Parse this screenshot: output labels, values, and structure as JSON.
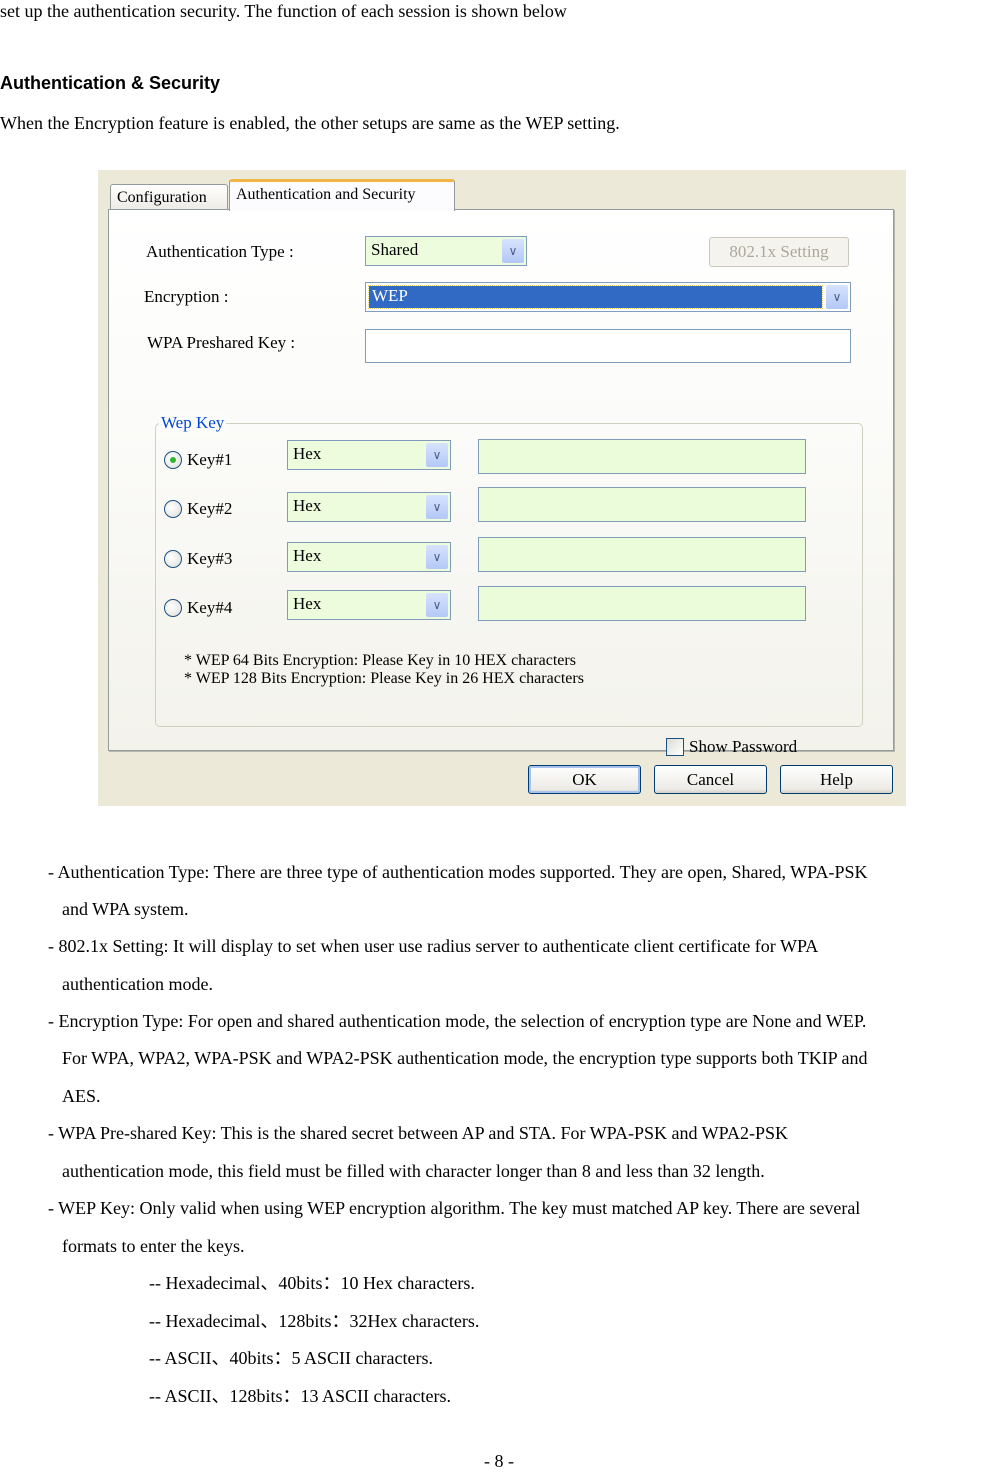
{
  "intro_text": "set up the authentication security. The function of each session is shown below",
  "section_heading": "Authentication & Security",
  "section_intro": "When the Encryption feature is enabled, the other setups are same as the WEP setting.",
  "dialog": {
    "tabs": [
      {
        "label": "Configuration",
        "active": false
      },
      {
        "label": "Authentication and Security",
        "active": true
      }
    ],
    "auth_type_label": "Authentication Type :",
    "auth_type_value": "Shared",
    "dot1x_button": "802.1x Setting",
    "encryption_label": "Encryption :",
    "encryption_value": "WEP",
    "wpa_psk_label": "WPA Preshared Key :",
    "wpa_psk_value": "",
    "wep_group_title": "Wep Key",
    "wep_keys": [
      {
        "label": "Key#1",
        "selected": true,
        "format": "Hex",
        "value": ""
      },
      {
        "label": "Key#2",
        "selected": false,
        "format": "Hex",
        "value": ""
      },
      {
        "label": "Key#3",
        "selected": false,
        "format": "Hex",
        "value": ""
      },
      {
        "label": "Key#4",
        "selected": false,
        "format": "Hex",
        "value": ""
      }
    ],
    "notes": [
      "* WEP 64 Bits Encryption:   Please Key in 10 HEX characters",
      "* WEP 128 Bits Encryption:   Please Key in 26 HEX characters"
    ],
    "show_password_label": "Show Password",
    "show_password_checked": false,
    "buttons": {
      "ok": "OK",
      "cancel": "Cancel",
      "help": "Help"
    },
    "colors": {
      "tab_accent": "#f2b444",
      "selection": "#316ac5",
      "group_title": "#0046d5",
      "field_bg": "#eafcd9"
    }
  },
  "descriptions": [
    {
      "lines": [
        "- Authentication Type: There are three type of authentication modes supported. They are open, Shared, WPA-PSK",
        "and WPA system."
      ]
    },
    {
      "lines": [
        "- 802.1x Setting: It will display to set when user use radius server to authenticate client certificate for WPA",
        "authentication mode."
      ]
    },
    {
      "lines": [
        "- Encryption Type: For open and shared authentication mode, the selection of encryption type are None and WEP.",
        "For WPA, WPA2, WPA-PSK and WPA2-PSK authentication mode, the encryption type supports both TKIP and",
        "AES."
      ]
    },
    {
      "lines": [
        "- WPA Pre-shared Key: This is the shared secret between AP and STA. For WPA-PSK and WPA2-PSK",
        "authentication mode, this field must be filled with character longer than 8 and less than 32 length."
      ]
    },
    {
      "lines": [
        "- WEP Key: Only valid when using WEP encryption algorithm. The key must matched AP key. There are several",
        "formats to enter the keys."
      ]
    }
  ],
  "key_formats": [
    "-- Hexadecimal、40bits：10 Hex characters.",
    "-- Hexadecimal、128bits：32Hex characters.",
    "-- ASCII、40bits：5 ASCII characters.",
    "-- ASCII、128bits：13 ASCII characters."
  ],
  "page_number": "- 8 -"
}
